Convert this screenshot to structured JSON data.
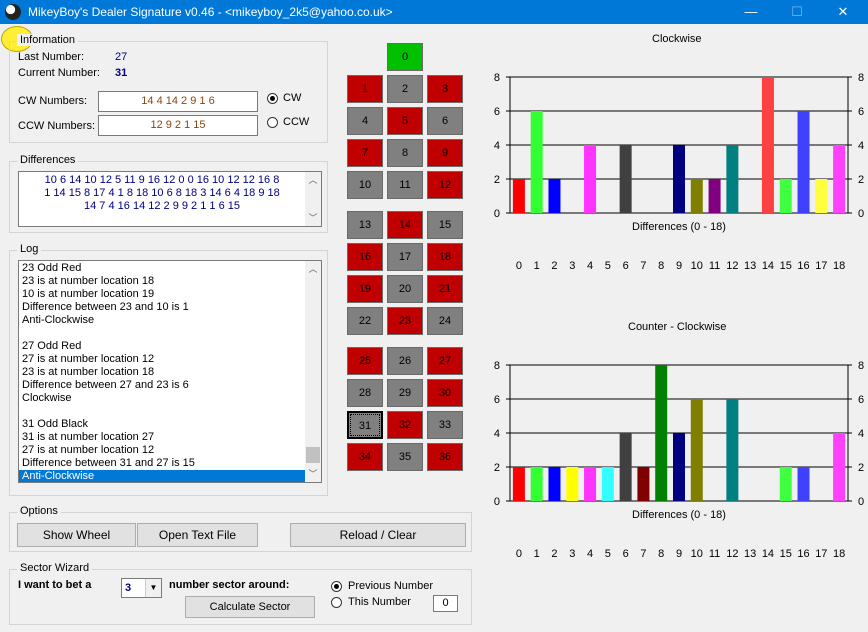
{
  "window": {
    "title": "MikeyBoy's Dealer Signature v0.46 - <mikeyboy_2k5@yahoo.co.uk>",
    "minimize": "—",
    "maximize": "☐",
    "close": "✕"
  },
  "information": {
    "legend": "Information",
    "last_number_label": "Last Number:",
    "last_number_value": "27",
    "current_number_label": "Current Number:",
    "current_number_value": "31",
    "cw_label": "CW Numbers:",
    "cw_value": "14 4 14 2 9 1 6",
    "ccw_label": "CCW Numbers:",
    "ccw_value": "12 9 2 1 15",
    "radio_cw": "CW",
    "radio_ccw": "CCW",
    "direction_selected": "CW"
  },
  "differences": {
    "legend": "Differences",
    "lines": [
      "10 6 14 10 12 5 11 9 16 12 0 0 16 10 12 12 16 8",
      "1 14 15 8 17 4 1 8 18 10 6 8 18 3 14 6 4 18 9 18",
      "14 7 4 16 14 12 2 9 9 2 1 1 6 15"
    ]
  },
  "log": {
    "legend": "Log",
    "lines": [
      "23    Odd Red",
      "23 is at number location 18",
      "10 is at number location 19",
      "Difference between 23 and 10 is 1",
      "Anti-Clockwise",
      "",
      "27    Odd Red",
      "27 is at number location 12",
      "23 is at number location 18",
      "Difference between 27 and 23 is 6",
      "Clockwise",
      "",
      "31    Odd Black",
      "31 is at number location 27",
      "27 is at number location 12",
      "Difference between 31 and 27 is 15",
      "Anti-Clockwise"
    ],
    "selected_index": 16
  },
  "wheel": {
    "zero": "0",
    "numbers": [
      [
        "1",
        "2",
        "3"
      ],
      [
        "4",
        "5",
        "6"
      ],
      [
        "7",
        "8",
        "9"
      ],
      [
        "10",
        "11",
        "12"
      ],
      [
        "13",
        "14",
        "15"
      ],
      [
        "16",
        "17",
        "18"
      ],
      [
        "19",
        "20",
        "21"
      ],
      [
        "22",
        "23",
        "24"
      ],
      [
        "25",
        "26",
        "27"
      ],
      [
        "28",
        "29",
        "30"
      ],
      [
        "31",
        "32",
        "33"
      ],
      [
        "34",
        "35",
        "36"
      ]
    ],
    "colors": [
      [
        "red",
        "black",
        "red"
      ],
      [
        "black",
        "red",
        "black"
      ],
      [
        "red",
        "black",
        "red"
      ],
      [
        "black",
        "black",
        "red"
      ],
      [
        "black",
        "red",
        "black"
      ],
      [
        "red",
        "black",
        "red"
      ],
      [
        "red",
        "black",
        "red"
      ],
      [
        "black",
        "red",
        "black"
      ],
      [
        "red",
        "black",
        "red"
      ],
      [
        "black",
        "black",
        "red"
      ],
      [
        "black",
        "red",
        "black"
      ],
      [
        "red",
        "black",
        "red"
      ]
    ],
    "selected": "31"
  },
  "options": {
    "legend": "Options",
    "show_wheel": "Show Wheel",
    "open_text_file": "Open Text File",
    "reload_clear": "Reload / Clear"
  },
  "sector_wizard": {
    "legend": "Sector Wizard",
    "bet_label": "I want to bet a",
    "sector_size": "3",
    "sector_label": "number sector around:",
    "previous_number": "Previous Number",
    "this_number": "This Number",
    "this_number_value": "0",
    "selected": "Previous Number",
    "calculate": "Calculate Sector"
  },
  "chart_data": [
    {
      "type": "bar",
      "title": "Clockwise",
      "xlabel": "Differences (0 - 18)",
      "categories": [
        "0",
        "1",
        "2",
        "3",
        "4",
        "5",
        "6",
        "7",
        "8",
        "9",
        "10",
        "11",
        "12",
        "13",
        "14",
        "15",
        "16",
        "17",
        "18"
      ],
      "values": [
        2,
        6,
        2,
        0,
        4,
        0,
        4,
        0,
        0,
        4,
        2,
        2,
        4,
        0,
        8,
        2,
        6,
        2,
        4
      ],
      "colors": [
        "#ff0000",
        "#33ff33",
        "#0000ff",
        "#ffff00",
        "#ff33ff",
        "#33ffff",
        "#404040",
        "#800000",
        "#008000",
        "#000080",
        "#808000",
        "#800080",
        "#008080",
        "#c0c0c0",
        "#ff4040",
        "#40ff40",
        "#4040ff",
        "#ffff40",
        "#ff40ff"
      ],
      "ylim": [
        0,
        8
      ],
      "yticks": [
        0,
        2,
        4,
        6,
        8
      ],
      "grid": true
    },
    {
      "type": "bar",
      "title": "Counter - Clockwise",
      "xlabel": "Differences (0 - 18)",
      "categories": [
        "0",
        "1",
        "2",
        "3",
        "4",
        "5",
        "6",
        "7",
        "8",
        "9",
        "10",
        "11",
        "12",
        "13",
        "14",
        "15",
        "16",
        "17",
        "18"
      ],
      "values": [
        2,
        2,
        2,
        2,
        2,
        2,
        4,
        2,
        8,
        4,
        6,
        0,
        6,
        0,
        0,
        2,
        2,
        0,
        4
      ],
      "colors": [
        "#ff0000",
        "#33ff33",
        "#0000ff",
        "#ffff00",
        "#ff33ff",
        "#33ffff",
        "#404040",
        "#800000",
        "#008000",
        "#000080",
        "#808000",
        "#800080",
        "#008080",
        "#c0c0c0",
        "#ff4040",
        "#40ff40",
        "#4040ff",
        "#ffff40",
        "#ff40ff"
      ],
      "ylim": [
        0,
        8
      ],
      "yticks": [
        0,
        2,
        4,
        6,
        8
      ],
      "grid": true
    }
  ]
}
